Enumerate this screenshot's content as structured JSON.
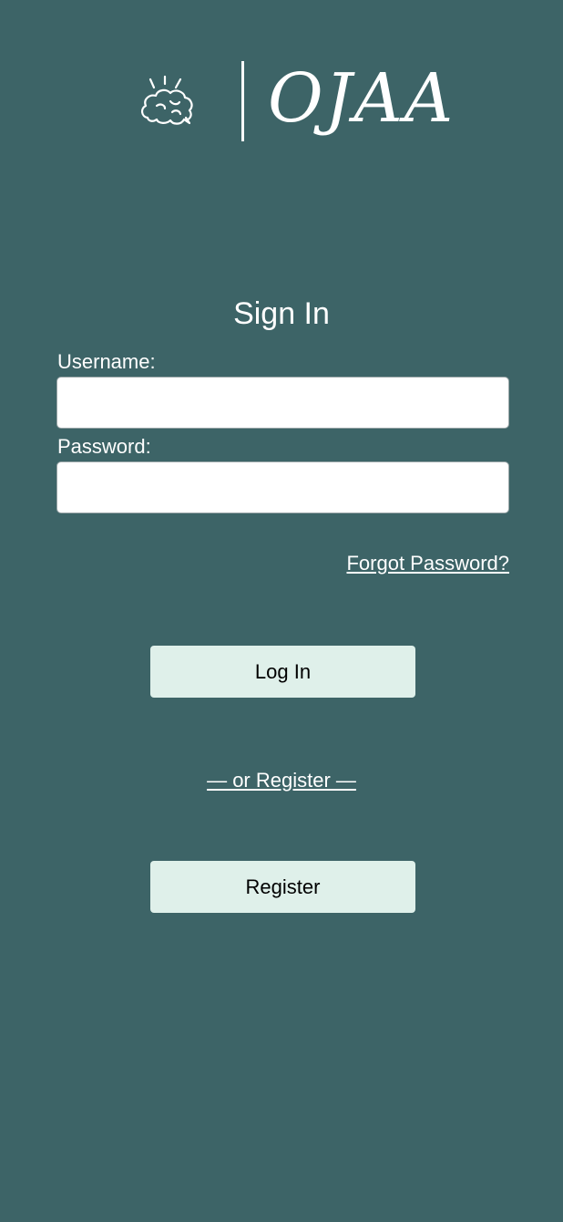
{
  "brand": {
    "name": "OJAA",
    "icon": "brain-idea-icon"
  },
  "signin": {
    "title": "Sign In",
    "username_label": "Username:",
    "username_value": "",
    "password_label": "Password:",
    "password_value": "",
    "forgot_password": "Forgot Password?",
    "login_button": "Log In",
    "or_register": "— or Register —",
    "register_button": "Register"
  },
  "colors": {
    "background": "#3d6467",
    "button_bg": "#dff0ea",
    "input_bg": "#ffffff",
    "text": "#ffffff"
  }
}
